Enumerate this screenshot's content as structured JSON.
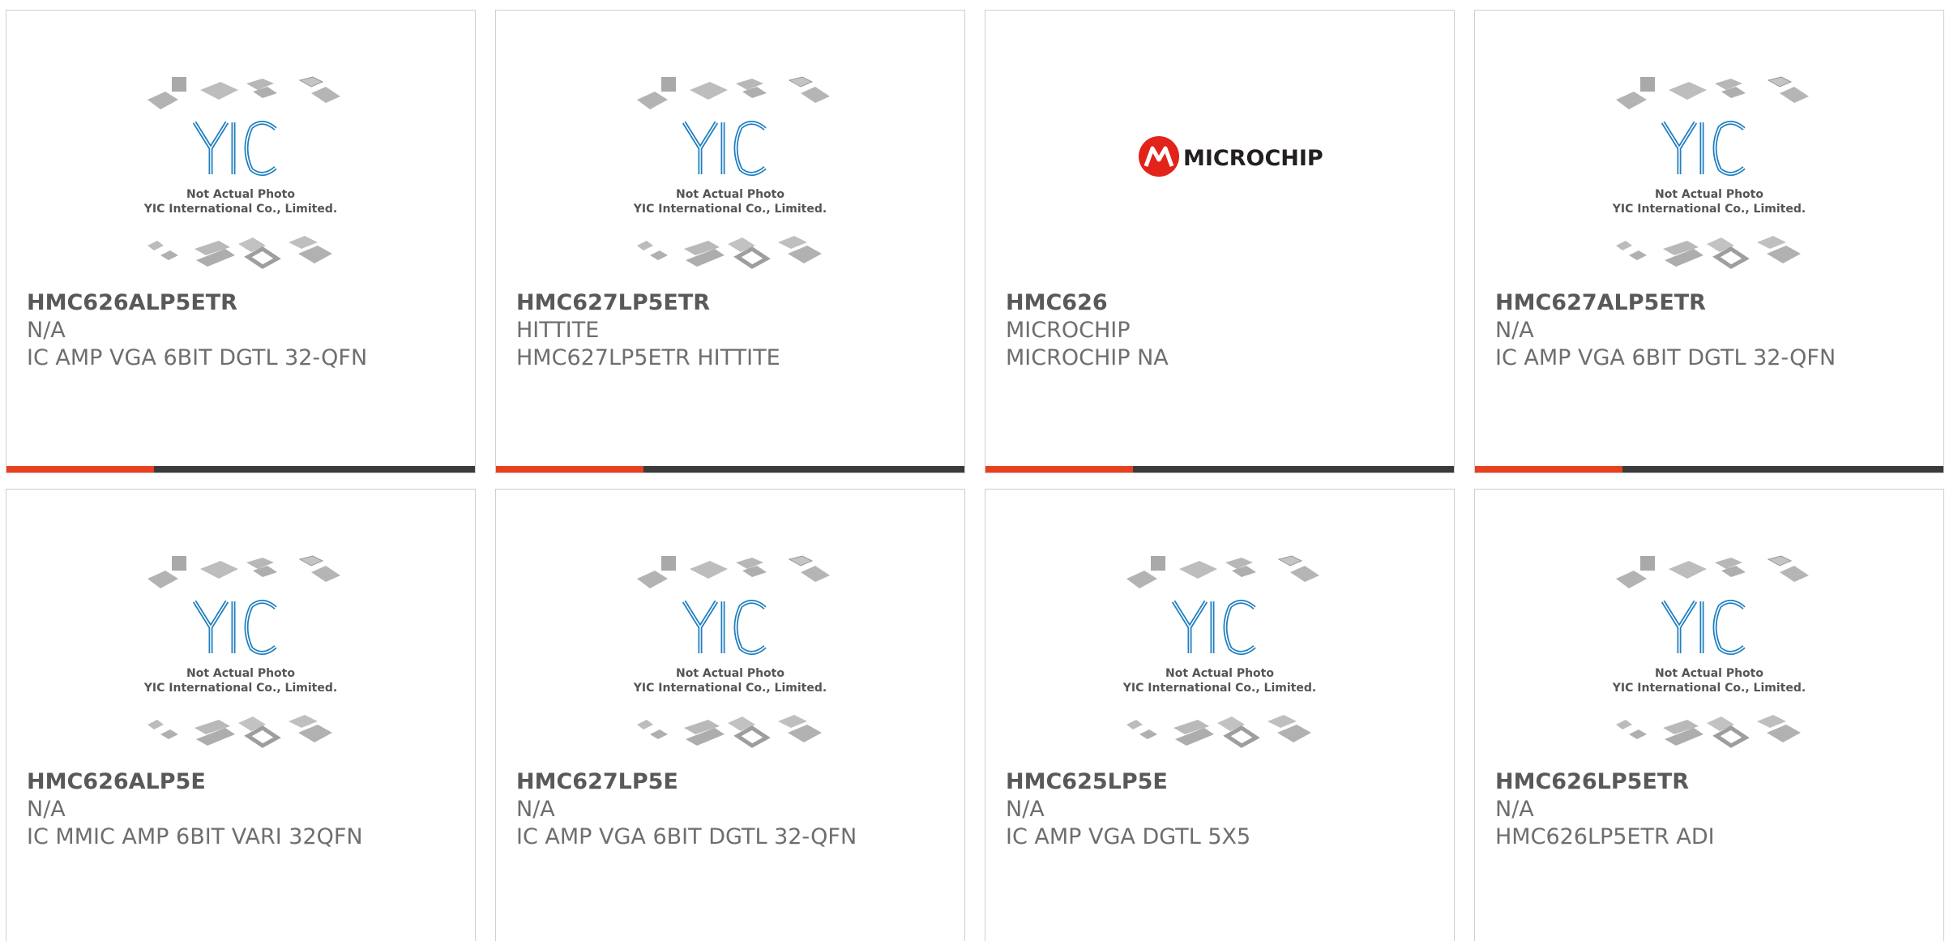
{
  "placeholder": {
    "line1": "Not Actual Photo",
    "line2": "YIC International Co., Limited.",
    "logo_text": "YIC"
  },
  "microchip_logo": {
    "text": "MICROCHIP"
  },
  "products": [
    {
      "part": "HMC626ALP5ETR",
      "brand": "N/A",
      "desc": "IC AMP VGA 6BIT DGTL 32-QFN",
      "image": "yic-placeholder"
    },
    {
      "part": "HMC627LP5ETR",
      "brand": "HITTITE",
      "desc": "HMC627LP5ETR HITTITE",
      "image": "yic-placeholder"
    },
    {
      "part": "HMC626",
      "brand": "MICROCHIP",
      "desc": "MICROCHIP NA",
      "image": "microchip-logo"
    },
    {
      "part": "HMC627ALP5ETR",
      "brand": "N/A",
      "desc": "IC AMP VGA 6BIT DGTL 32-QFN",
      "image": "yic-placeholder"
    },
    {
      "part": "HMC626ALP5E",
      "brand": "N/A",
      "desc": "IC MMIC AMP 6BIT VARI 32QFN",
      "image": "yic-placeholder"
    },
    {
      "part": "HMC627LP5E",
      "brand": "N/A",
      "desc": "IC AMP VGA 6BIT DGTL 32-QFN",
      "image": "yic-placeholder"
    },
    {
      "part": "HMC625LP5E",
      "brand": "N/A",
      "desc": "IC AMP VGA DGTL 5X5",
      "image": "yic-placeholder"
    },
    {
      "part": "HMC626LP5ETR",
      "brand": "N/A",
      "desc": "HMC626LP5ETR ADI",
      "image": "yic-placeholder"
    }
  ],
  "colors": {
    "accent": "#e8401c",
    "bar": "#3a3a3a",
    "yic_blue": "#1f7fc0",
    "microchip_red": "#e2231a"
  }
}
